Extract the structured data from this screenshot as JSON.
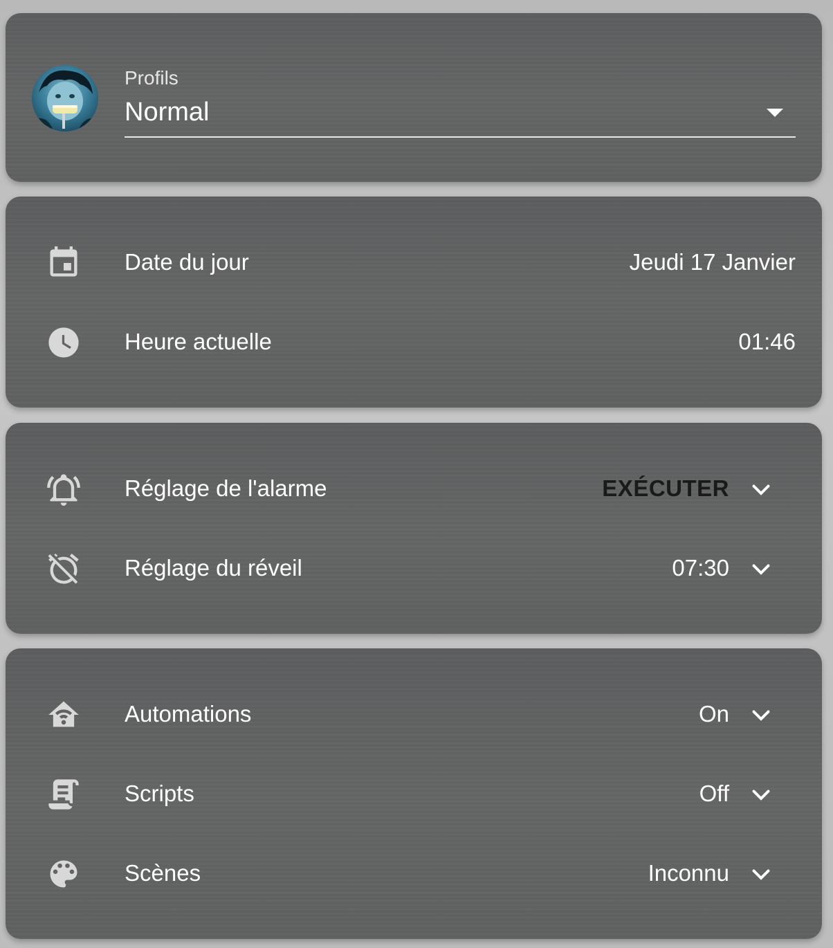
{
  "profile": {
    "label": "Profils",
    "selected": "Normal",
    "avatar_icon": "user-avatar-photo",
    "dropdown_icon": "caret-down-icon"
  },
  "datetime": {
    "rows": [
      {
        "icon": "calendar-icon",
        "label": "Date du jour",
        "value": "Jeudi 17 Janvier"
      },
      {
        "icon": "clock-icon",
        "label": "Heure actuelle",
        "value": "01:46"
      }
    ]
  },
  "alarm": {
    "rows": [
      {
        "icon": "bell-ring-icon",
        "label": "Réglage de l'alarme",
        "value": "EXÉCUTER",
        "chevron": "chevron-down-icon"
      },
      {
        "icon": "alarm-off-icon",
        "label": "Réglage du réveil",
        "value": "07:30",
        "chevron": "chevron-down-icon"
      }
    ]
  },
  "automation": {
    "rows": [
      {
        "icon": "home-automation-icon",
        "label": "Automations",
        "value": "On",
        "chevron": "chevron-down-icon"
      },
      {
        "icon": "script-icon",
        "label": "Scripts",
        "value": "Off",
        "chevron": "chevron-down-icon"
      },
      {
        "icon": "palette-icon",
        "label": "Scènes",
        "value": "Inconnu",
        "chevron": "chevron-down-icon"
      }
    ]
  },
  "colors": {
    "card_bg": "#5f6060",
    "page_bg": "#c0c0c0",
    "text": "#ffffff",
    "icon": "#d8d8d8",
    "button_text": "#1a1a1a"
  }
}
